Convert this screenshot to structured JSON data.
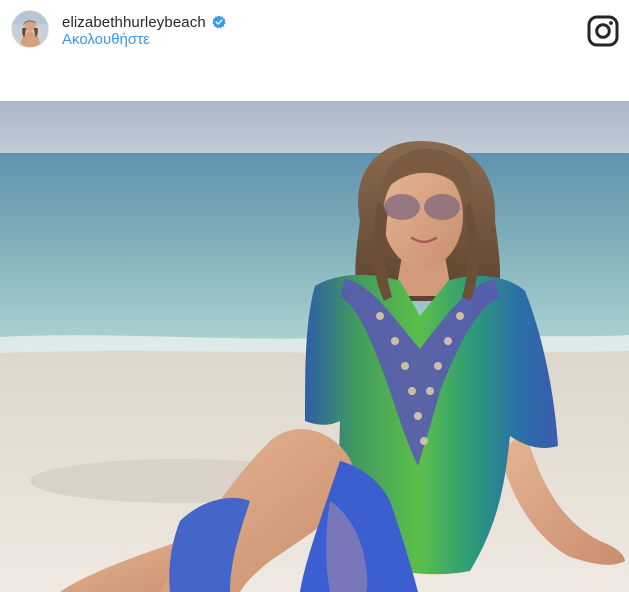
{
  "post": {
    "username": "elizabethhurleybeach",
    "follow_label": "Ακολουθήστε",
    "verified": true,
    "image_alt": "Woman sitting on a white sand beach wearing a green and blue embellished kaftan and sunglasses"
  },
  "icons": {
    "avatar": "profile-avatar",
    "verified": "verified-badge-icon",
    "brand": "instagram-icon"
  },
  "colors": {
    "link": "#3897f0",
    "verified_badge": "#3897f0",
    "text": "#262626"
  }
}
